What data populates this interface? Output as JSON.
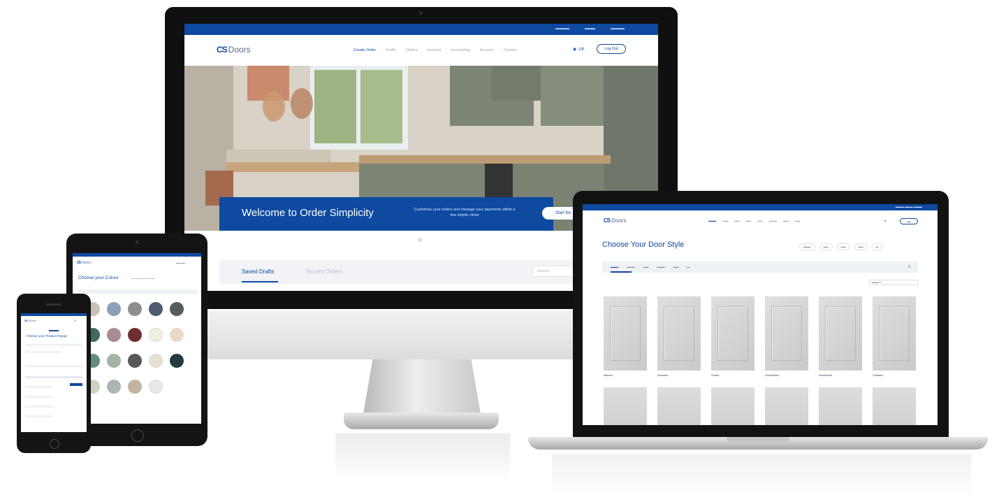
{
  "monitor": {
    "nav": {
      "logo_mark": "CS",
      "logo_word": "Doors",
      "items": [
        "Create Order",
        "Drafts",
        "Orders",
        "Invoices",
        "Accounting",
        "Account",
        "Contact"
      ],
      "language": "UK",
      "logout_label": "Log Out"
    },
    "hero": {
      "title": "Welcome to Order Simplicity",
      "description": "Customise your orders and manage your payments within a few simple clicks",
      "button_label": "Start No"
    },
    "tabs": {
      "saved": "Saved Drafts",
      "recent": "Recent Orders"
    },
    "search_placeholder": "Search..."
  },
  "laptop": {
    "nav": {
      "logo_mark": "CS",
      "logo_word": "Doors"
    },
    "page_title": "Choose Your Door Style",
    "doors": [
      {
        "name": "Malvern"
      },
      {
        "name": "Sheraton"
      },
      {
        "name": "Oxford"
      },
      {
        "name": "Lincolnshire"
      },
      {
        "name": "Rowshome"
      },
      {
        "name": "Chiswick"
      }
    ]
  },
  "tablet": {
    "logo_mark": "CS",
    "logo_word": "Doors",
    "title": "Choose your Colour",
    "swatch_colors": [
      "#c8c2bb",
      "#8b9fb8",
      "#8e8f8f",
      "#4c5a72",
      "#585b5c",
      "#3e6a60",
      "#a88c93",
      "#6e2e2f",
      "#f1efe0",
      "#ead8c8",
      "#5f8e7c",
      "#a4b3a2",
      "#56585b",
      "#e6e0cf",
      "#233b3e",
      "#cdd1c5",
      "#a9b6b3",
      "#c3b4a1",
      "#e9e8e4"
    ]
  },
  "phone": {
    "logo_mark": "CS",
    "logo_word": "Doors",
    "title": "Choose your Product Range"
  },
  "colors": {
    "brand_blue": "#0d4aa0",
    "device_black": "#121212"
  }
}
